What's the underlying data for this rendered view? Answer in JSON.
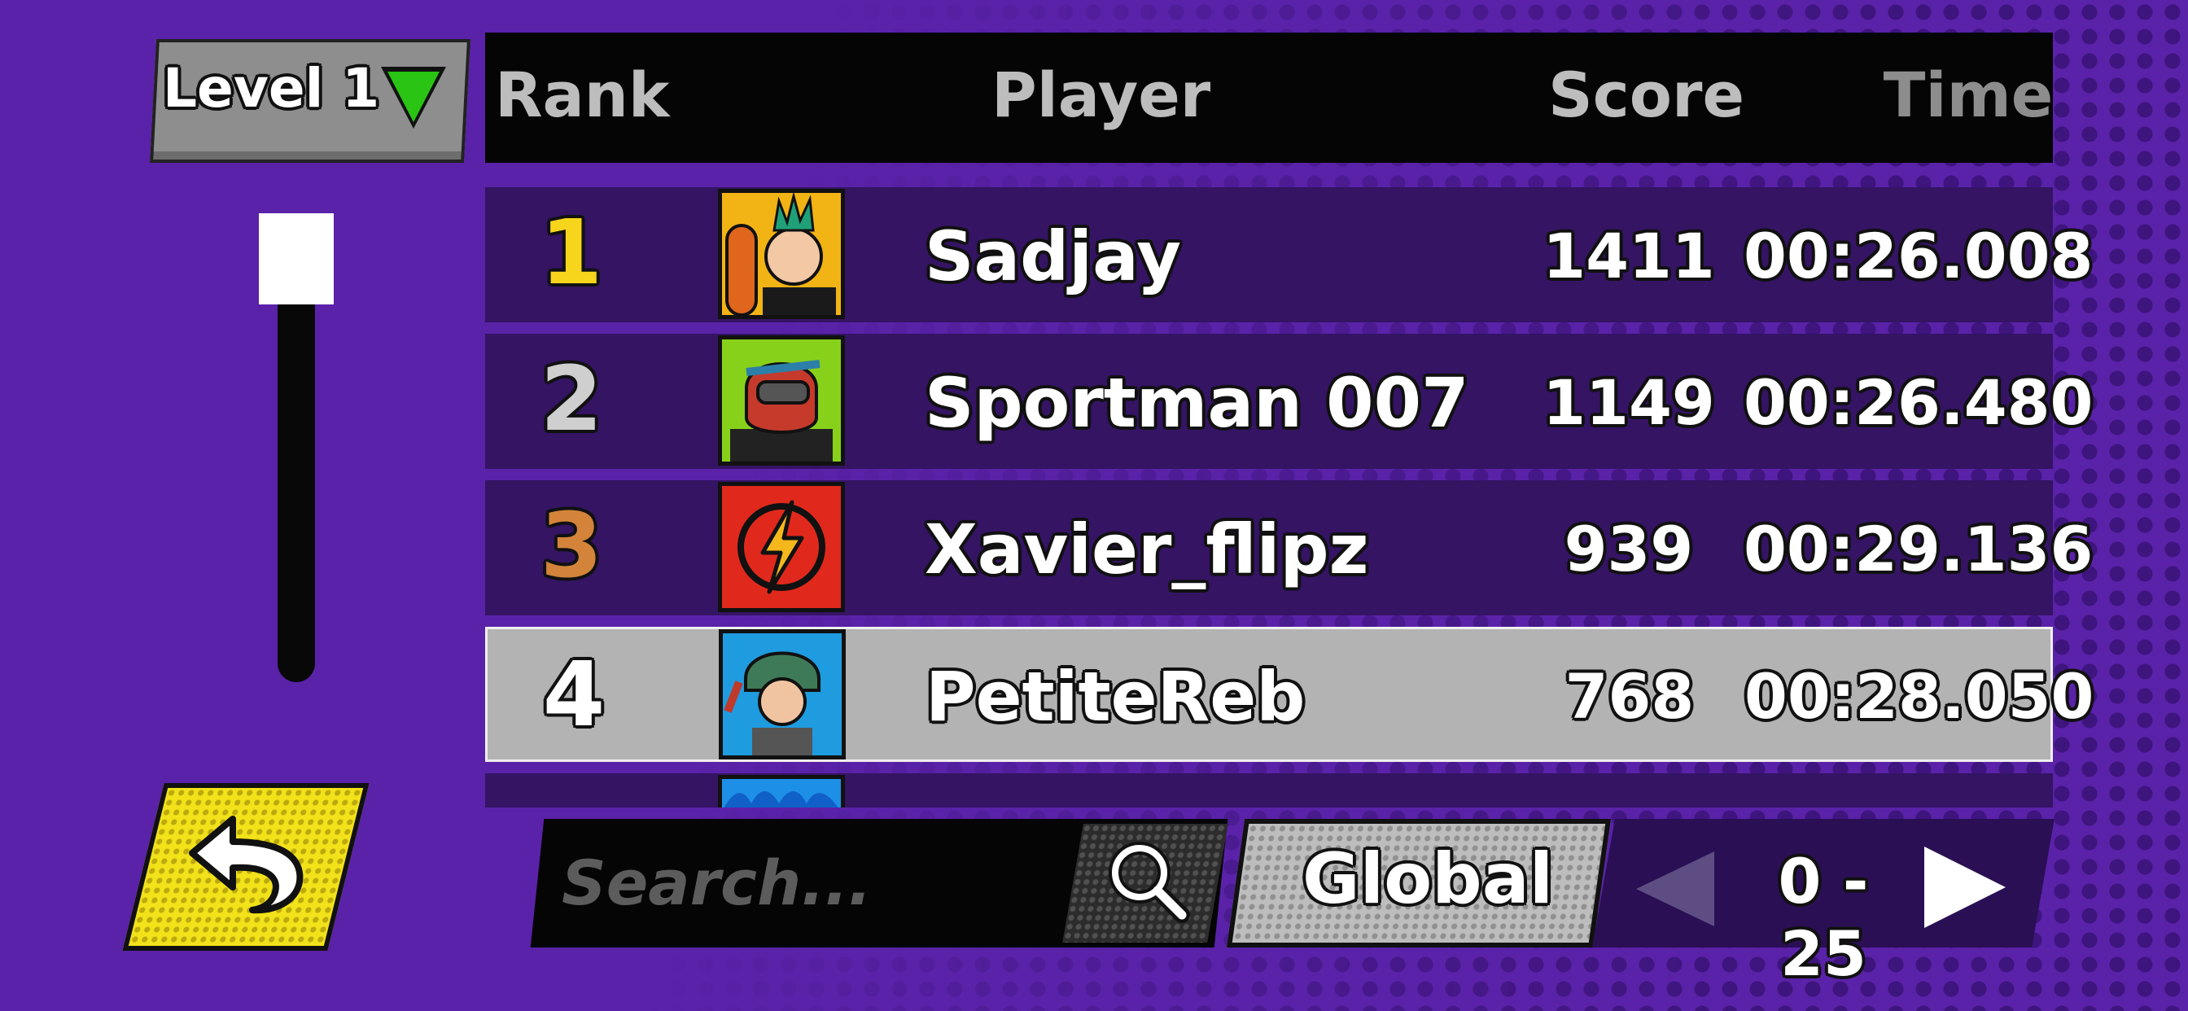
{
  "level_selector": {
    "label": "Level 1",
    "icon": "triangle-down-icon",
    "icon_color": "#29c414"
  },
  "table": {
    "headers": {
      "rank": "Rank",
      "player": "Player",
      "score": "Score",
      "time": "Time"
    },
    "rows": [
      {
        "rank": "1",
        "rank_color": "#f7d51d",
        "player": "Sadjay",
        "score": "1411",
        "time": "00:26.008",
        "avatar": "punk-surfer-avatar"
      },
      {
        "rank": "2",
        "rank_color": "#cfcfcf",
        "player": "Sportman 007",
        "score": "1149",
        "time": "00:26.480",
        "avatar": "motocross-helmet-avatar"
      },
      {
        "rank": "3",
        "rank_color": "#d3843a",
        "player": "Xavier_flipz",
        "score": "939",
        "time": "00:29.136",
        "avatar": "lightning-bolt-avatar"
      },
      {
        "rank": "4",
        "rank_color": "#ffffff",
        "player": "PetiteReb",
        "score": "768",
        "time": "00:28.050",
        "avatar": "rider-girl-avatar",
        "highlighted": true
      }
    ]
  },
  "search": {
    "placeholder": "Search..."
  },
  "scope_button": {
    "label": "Global"
  },
  "pager": {
    "range": "0 - 25"
  },
  "colors": {
    "background": "#5a22a8",
    "row": "#341463",
    "highlight_row": "#b3b3b3"
  }
}
